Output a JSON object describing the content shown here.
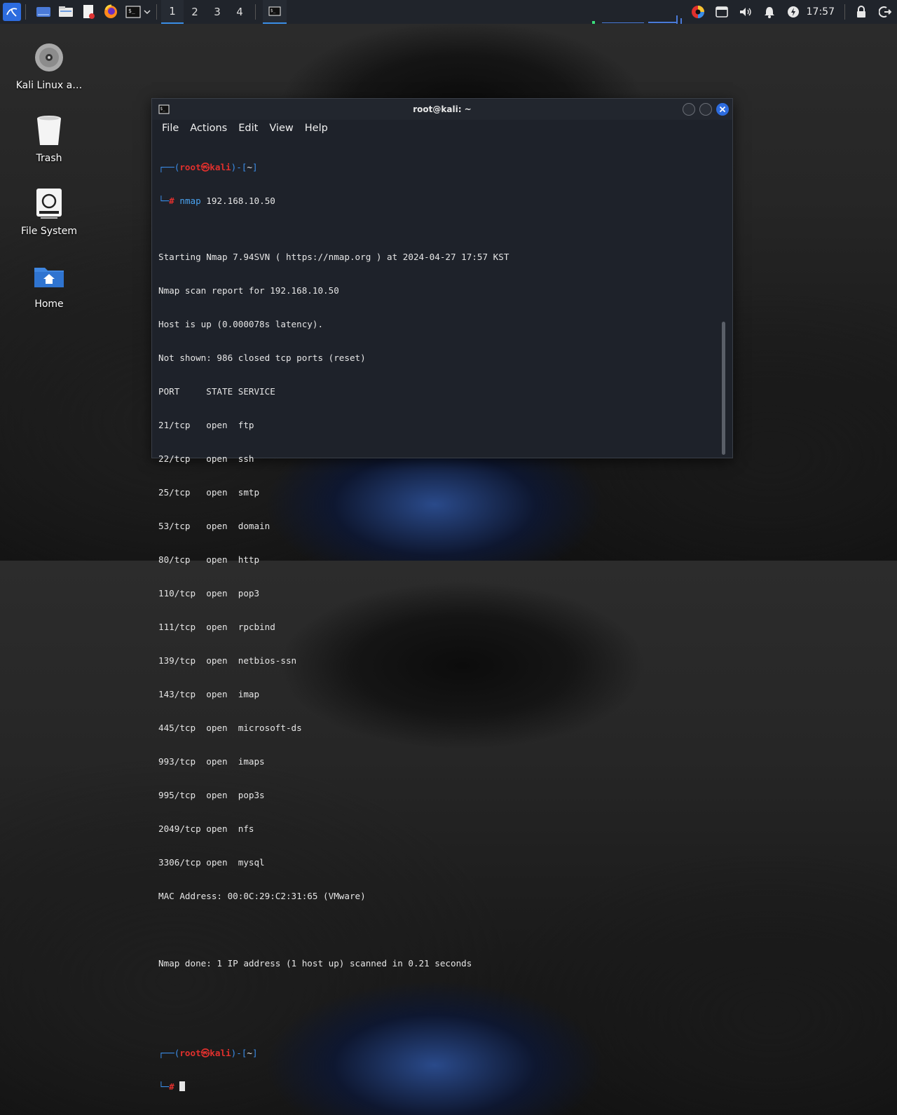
{
  "panel": {
    "workspaces": [
      "1",
      "2",
      "3",
      "4"
    ],
    "active_workspace": "1",
    "clock": "17:57"
  },
  "desktop": {
    "icons": [
      {
        "label": "Kali Linux a…",
        "icon": "disc-icon"
      },
      {
        "label": "Trash",
        "icon": "trash-icon"
      },
      {
        "label": "File System",
        "icon": "drive-icon"
      },
      {
        "label": "Home",
        "icon": "home-folder-icon"
      }
    ]
  },
  "terminal": {
    "title": "root@kali: ~",
    "menu": [
      "File",
      "Actions",
      "Edit",
      "View",
      "Help"
    ],
    "prompt": {
      "open": "┌──(",
      "user": "root",
      "sep": "㉿",
      "host": "kali",
      "close": ")-[",
      "dir": "~",
      "end": "]",
      "corner": "└─",
      "hash": "#"
    },
    "command_name": "nmap",
    "command_args": " 192.168.10.50",
    "output": [
      "Starting Nmap 7.94SVN ( https://nmap.org ) at 2024-04-27 17:57 KST",
      "Nmap scan report for 192.168.10.50",
      "Host is up (0.000078s latency).",
      "Not shown: 986 closed tcp ports (reset)",
      "PORT     STATE SERVICE",
      "21/tcp   open  ftp",
      "22/tcp   open  ssh",
      "25/tcp   open  smtp",
      "53/tcp   open  domain",
      "80/tcp   open  http",
      "110/tcp  open  pop3",
      "111/tcp  open  rpcbind",
      "139/tcp  open  netbios-ssn",
      "143/tcp  open  imap",
      "445/tcp  open  microsoft-ds",
      "993/tcp  open  imaps",
      "995/tcp  open  pop3s",
      "2049/tcp open  nfs",
      "3306/tcp open  mysql",
      "MAC Address: 00:0C:29:C2:31:65 (VMware)",
      "",
      "Nmap done: 1 IP address (1 host up) scanned in 0.21 seconds",
      ""
    ]
  },
  "colors": {
    "accent": "#3a8ee6",
    "prompt_red": "#e0302d",
    "prompt_blue": "#3b8eea"
  }
}
